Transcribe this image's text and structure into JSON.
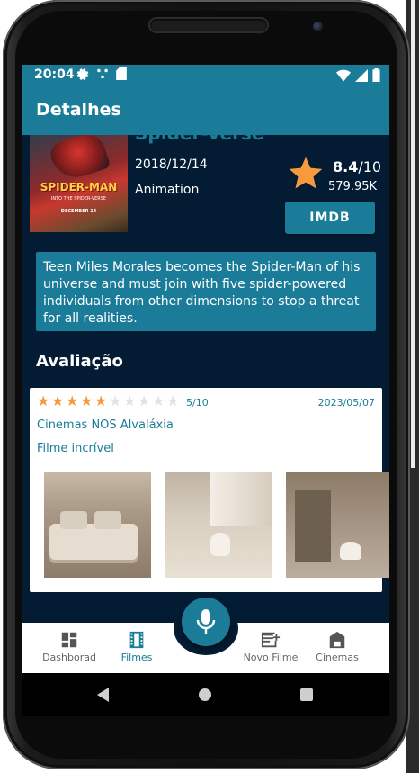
{
  "status_bar": {
    "time": "20:04",
    "left_icons": [
      "gear-icon",
      "dots-icon",
      "sim-icon"
    ],
    "right_icons": [
      "wifi-icon",
      "signal-icon",
      "battery-icon"
    ]
  },
  "app_bar": {
    "title": "Detalhes"
  },
  "movie": {
    "title_partial": "Spider-Verse",
    "poster_title": "SPIDER-MAN",
    "poster_subtitle": "INTO THE SPIDER-VERSE",
    "poster_date": "DECEMBER 14",
    "release_date": "2018/12/14",
    "genre": "Animation",
    "rating": "8.4",
    "rating_max": "/10",
    "votes": "579.95K",
    "imdb_label": "IMDB",
    "synopsis": "Teen Miles Morales becomes the Spider-Man of his universe and must join with five spider-powered individuals from other dimensions to stop a threat for all realities."
  },
  "reviews": {
    "section_title": "Avaliação",
    "items": [
      {
        "stars_filled": 5,
        "stars_total": 10,
        "score": "5/10",
        "date": "2023/05/07",
        "cinema": "Cinemas NOS Alvaláxia",
        "text": "Filme incrível",
        "photos": [
          "living-room-photo",
          "room-with-dog-photo",
          "hallway-with-dog-photo"
        ]
      }
    ]
  },
  "bottom_nav": {
    "items": [
      {
        "label": "Dashborad",
        "icon": "dashboard-icon",
        "active": false
      },
      {
        "label": "Filmes",
        "icon": "film-icon",
        "active": true
      },
      {
        "label": "Novo Filme",
        "icon": "new-film-icon",
        "active": false
      },
      {
        "label": "Cinemas",
        "icon": "cinema-icon",
        "active": false
      }
    ],
    "fab_icon": "microphone-icon"
  },
  "colors": {
    "primary": "#1a7c98",
    "background": "#031c33",
    "star": "#f79a3d"
  }
}
